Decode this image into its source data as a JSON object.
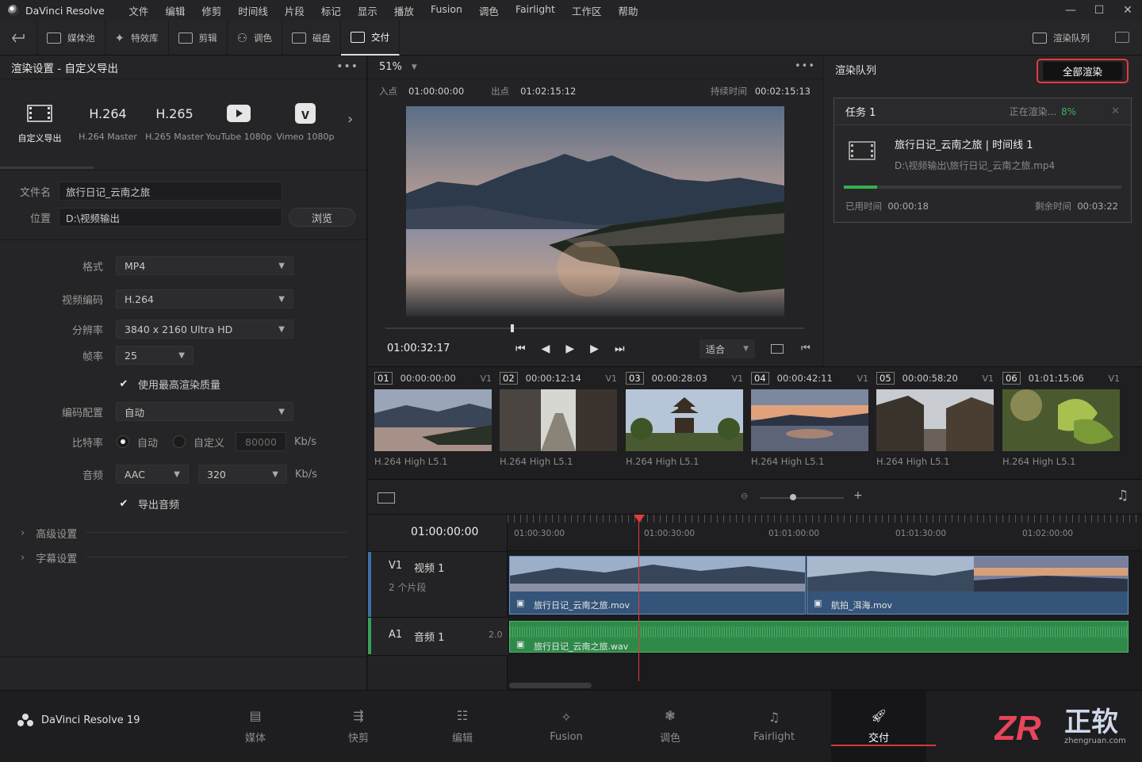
{
  "titlebar": {
    "app_name": "DaVinci Resolve",
    "menus": [
      "文件",
      "编辑",
      "修剪",
      "时间线",
      "片段",
      "标记",
      "显示",
      "播放",
      "Fusion",
      "调色",
      "Fairlight",
      "工作区",
      "帮助"
    ]
  },
  "toolbar": {
    "media_pool": "媒体池",
    "effects": "特效库",
    "edit_index": "剪辑",
    "color": "调色",
    "fx": "磁盘",
    "deliver": "交付",
    "render_queue": "渲染队列"
  },
  "render_settings": {
    "title": "渲染设置 - 自定义导出",
    "presets": [
      {
        "big": "",
        "label": "自定义导出"
      },
      {
        "big": "H.264",
        "label": "H.264 Master"
      },
      {
        "big": "H.265",
        "label": "H.265 Master"
      },
      {
        "big": "",
        "label": "YouTube 1080p"
      },
      {
        "big": "",
        "label": "Vimeo 1080p"
      }
    ],
    "filename_label": "文件名",
    "filename_value": "旅行日记_云南之旅",
    "location_label": "位置",
    "location_value": "D:\\视频输出",
    "browse": "浏览",
    "format_label": "格式",
    "format_value": "MP4",
    "codec_label": "视频编码",
    "codec_value": "H.264",
    "resolution_label": "分辨率",
    "resolution_value": "3840 x 2160  Ultra HD",
    "framerate_label": "帧率",
    "framerate_value": "25",
    "max_quality": "使用最高渲染质量",
    "encode_profile_label": "编码配置",
    "encode_profile_value": "自动",
    "bitrate_label": "比特率",
    "bitrate_auto": "自动",
    "bitrate_custom": "自定义",
    "bitrate_value": "80000",
    "bitrate_unit": "Kb/s",
    "audio_label": "音频",
    "audio_codec": "AAC",
    "audio_bitrate": "320",
    "audio_unit": "Kb/s",
    "export_audio": "导出音频",
    "advanced": "高级设置",
    "subtitles": "字幕设置"
  },
  "viewer": {
    "zoom": "51%",
    "in_label": "入点",
    "in_tc": "01:00:00:00",
    "out_label": "出点",
    "out_tc": "01:02:15:12",
    "duration_label": "持续时间",
    "duration_tc": "00:02:15:13",
    "current_tc": "01:00:32:17",
    "fit": "适合",
    "scrub_position": 0.3
  },
  "render_queue": {
    "title": "渲染队列",
    "render_all": "全部渲染",
    "job": {
      "name": "任务 1",
      "status": "正在渲染...",
      "percent": "8%",
      "progress": 0.08,
      "title": "旅行日记_云南之旅 | 时间线 1",
      "path": "D:\\视频输出\\旅行日记_云南之旅.mp4",
      "elapsed_label": "已用时间",
      "elapsed": "00:00:18",
      "remaining_label": "剩余时间",
      "remaining": "00:03:22"
    }
  },
  "clips": [
    {
      "num": "01",
      "tc": "00:00:00:00",
      "track": "V1",
      "codec": "H.264 High L5.1"
    },
    {
      "num": "02",
      "tc": "00:00:12:14",
      "track": "V1",
      "codec": "H.264 High L5.1"
    },
    {
      "num": "03",
      "tc": "00:00:28:03",
      "track": "V1",
      "codec": "H.264 High L5.1"
    },
    {
      "num": "04",
      "tc": "00:00:42:11",
      "track": "V1",
      "codec": "H.264 High L5.1"
    },
    {
      "num": "05",
      "tc": "00:00:58:20",
      "track": "V1",
      "codec": "H.264 High L5.1"
    },
    {
      "num": "06",
      "tc": "01:01:15:06",
      "track": "V1",
      "codec": "H.264 High L5.1"
    }
  ],
  "timeline": {
    "timecode": "01:00:00:00",
    "ruler": [
      "01:00:30:00",
      "01:00:30:00",
      "01:01:00:00",
      "01:01:30:00",
      "01:02:00:00"
    ],
    "v1_label": "V1",
    "v1_name": "视频 1",
    "v1_count": "2 个片段",
    "a1_label": "A1",
    "a1_name": "音频 1",
    "a1_channels": "2.0",
    "video_clip_1": "旅行日记_云南之旅.mov",
    "video_clip_2": "航拍_洱海.mov",
    "audio_clip": "旅行日记_云南之旅.wav"
  },
  "pages": {
    "product": "DaVinci Resolve 19",
    "media": "媒体",
    "cut": "快剪",
    "edit": "编辑",
    "fusion": "Fusion",
    "color": "调色",
    "fairlight": "Fairlight",
    "deliver": "交付"
  },
  "watermark": {
    "text": "正软",
    "url": "zhengruan.com"
  }
}
